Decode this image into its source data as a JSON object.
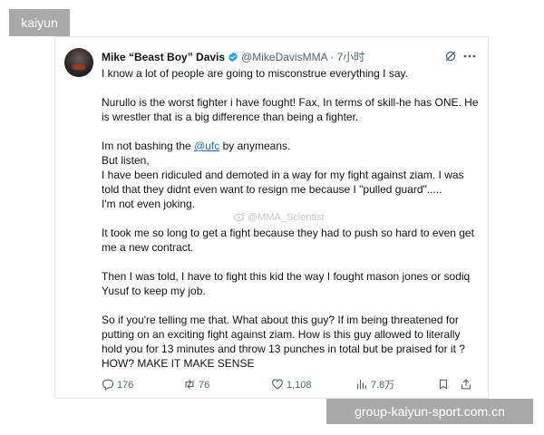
{
  "site": {
    "brand": "kaiyun",
    "url": "group-kaiyun-sport.com.cn"
  },
  "tweet": {
    "display_name": "Mike “Beast Boy” Davis",
    "handle": "@MikeDavisMMA",
    "separator": "·",
    "time": "7小时",
    "verified_color": "#1d9bf0",
    "icons": {
      "verified": "verified-badge-icon",
      "grok": "grok-icon",
      "more": "more-icon"
    },
    "paragraphs": {
      "p1": "I know a lot of people are going to misconstrue everything I say.",
      "p2": "Nurullo is the worst fighter i have fought! Fax, In terms of skill-he has ONE. He is wrestler that is a big difference than being a fighter.",
      "p3_before": "Im not bashing the ",
      "p3_mention": "@ufc",
      "p3_after": " by anymeans.",
      "p3b": "But listen,",
      "p3c": "I have been ridiculed and demoted in a way for my fight against ziam. I was told that they didnt even want to resign me because I \"pulled guard\".....",
      "p3d": "I'm not even joking.",
      "p4": "It took me so long to get a fight because they had to push so hard to even get me a new contract.",
      "p5": "Then I was told, I have to fight this kid the way I fought mason jones or sodiq Yusuf to keep my job.",
      "p6": "So if you're telling me that. What about this guy? If im being threatened for putting on an exciting fight against ziam. How is this guy allowed to literally hold you for 13 minutes and throw 13 punches in total but be praised for it ?",
      "p7": "HOW? MAKE IT MAKE SENSE"
    },
    "watermark": "@MMA_Scientist",
    "actions": {
      "replies": "176",
      "retweets": "76",
      "likes": "1,108",
      "views": "7.8万"
    },
    "mention_color": "#1d6fb8"
  }
}
